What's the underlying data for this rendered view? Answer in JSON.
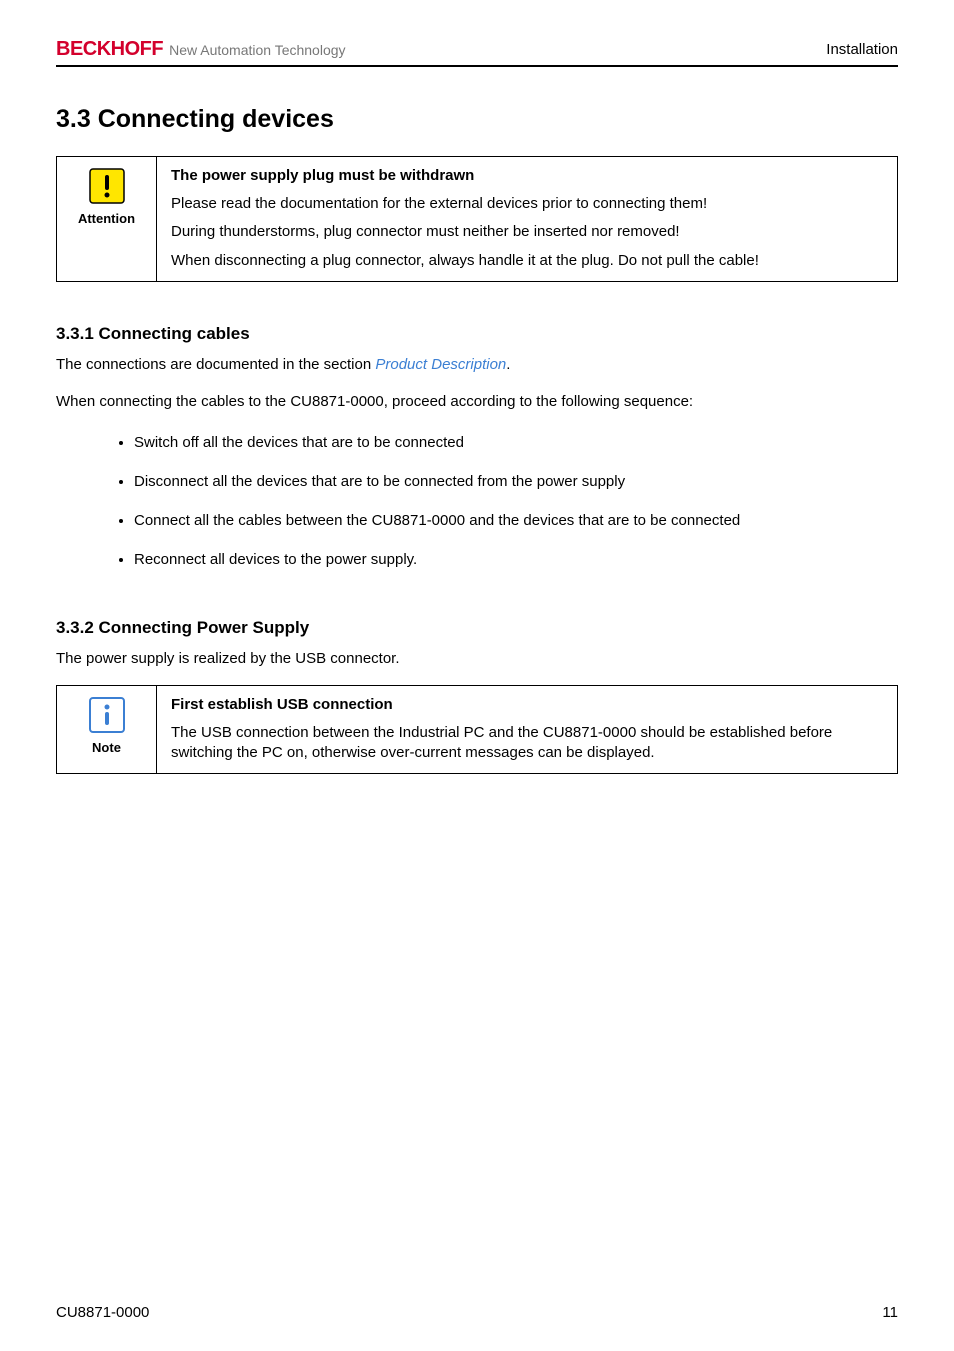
{
  "header": {
    "brand_logo": "BECKHOFF",
    "brand_tagline": "New Automation Technology",
    "right": "Installation"
  },
  "section": {
    "title": "3.3 Connecting devices"
  },
  "attention": {
    "label": "Attention",
    "head": "The power supply plug must be withdrawn",
    "p1": "Please read the documentation for the external devices prior to connecting them!",
    "p2": "During thunderstorms, plug connector must neither be inserted nor removed!",
    "p3": "When disconnecting a plug connector, always handle it at the plug. Do not pull the cable!"
  },
  "sub1": {
    "title": "3.3.1 Connecting cables",
    "intro_pre": "The connections are documented in the section ",
    "intro_link": "Product Description",
    "intro_post": ".",
    "p2": "When connecting the cables to the CU8871-0000, proceed according to the following sequence:",
    "bullets": [
      "Switch off all the devices that are to be connected",
      "Disconnect all the devices that are to be connected from the power supply",
      "Connect all the cables between the CU8871-0000 and the devices that are to be connected",
      "Reconnect all devices to the power supply."
    ]
  },
  "sub2": {
    "title": "3.3.2 Connecting Power Supply",
    "intro": "The power supply is realized by the USB connector."
  },
  "note": {
    "label": "Note",
    "head": "First establish USB connection",
    "p1": "The USB connection between the Industrial PC and the CU8871-0000 should be established before switching the PC on, otherwise over-current messages can be displayed."
  },
  "footer": {
    "left": "CU8871-0000",
    "right": "11"
  }
}
